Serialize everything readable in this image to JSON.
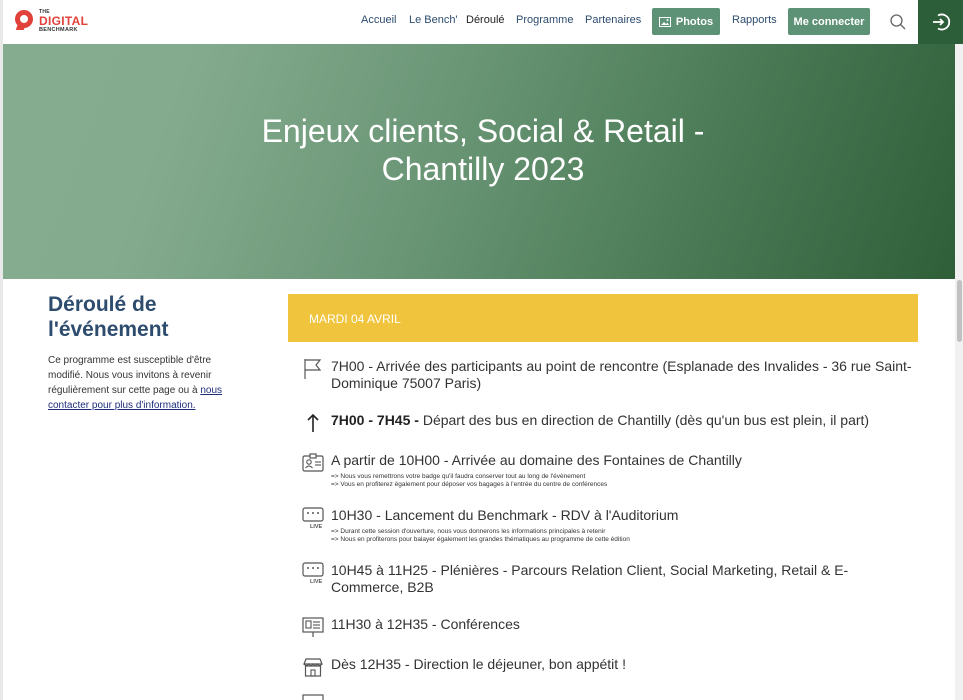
{
  "logo": {
    "line1": "THE",
    "line2": "DIGITAL",
    "line3": "BENCHMARK"
  },
  "nav": {
    "items": [
      "Accueil",
      "Le Bench'",
      "Déroulé",
      "Programme",
      "Partenaires"
    ],
    "photos": "Photos",
    "rapports": "Rapports",
    "connect": "Me connecter"
  },
  "hero": {
    "title_line1": "Enjeux clients, Social & Retail -",
    "title_line2": "Chantilly 2023"
  },
  "sidebar": {
    "title": "Déroulé de l'événement",
    "text": "Ce programme est susceptible d'être modifié. Nous vous invitons à revenir régulièrement sur cette page ou à ",
    "link": "nous contacter pour plus d'information."
  },
  "day": {
    "label": "MARDI 04 AVRIL"
  },
  "schedule": [
    {
      "icon": "flag-icon",
      "title": "7H00 - Arrivée des participants au point de rencontre (Esplanade des Invalides - 36 rue Saint-Dominique 75007 Paris)"
    },
    {
      "icon": "arrow-up-icon",
      "time": "7H00 - 7H45 -",
      "title": " Départ des bus en direction de Chantilly (dès qu'un bus est plein, il part)"
    },
    {
      "icon": "badge-icon",
      "title": "A partir de 10H00 - Arrivée au domaine des Fontaines de Chantilly",
      "sub1": "=> Nous vous remettrons votre badge qu'il faudra conserver tout au long de l'évènement",
      "sub2": "=> Vous en profiterez également pour déposer vos bagages à l'entrée du centre de conférences"
    },
    {
      "icon": "live-icon",
      "title": "10H30 - Lancement du Benchmark - RDV à l'Auditorium",
      "sub1": "=> Durant cette session d'ouverture, nous vous donnerons les informations principales à retenir",
      "sub2": "=> Nous en profiterons pour balayer également les grandes thématiques au programme de cette édition"
    },
    {
      "icon": "live-icon",
      "title": "10H45 à 11H25 - Plénières - Parcours Relation Client, Social Marketing, Retail & E-Commerce, B2B"
    },
    {
      "icon": "presentation-icon",
      "title": "11H30 à 12H35 - Conférences"
    },
    {
      "icon": "store-icon",
      "title": "Dès 12H35 - Direction le déjeuner, bon appétit !"
    }
  ],
  "colors": {
    "nav_text": "#2d4c6e",
    "green_button": "#5e9276",
    "login_bg": "#2d5e3a",
    "day_banner": "#f0c43d",
    "logo_red": "#e2403a"
  }
}
